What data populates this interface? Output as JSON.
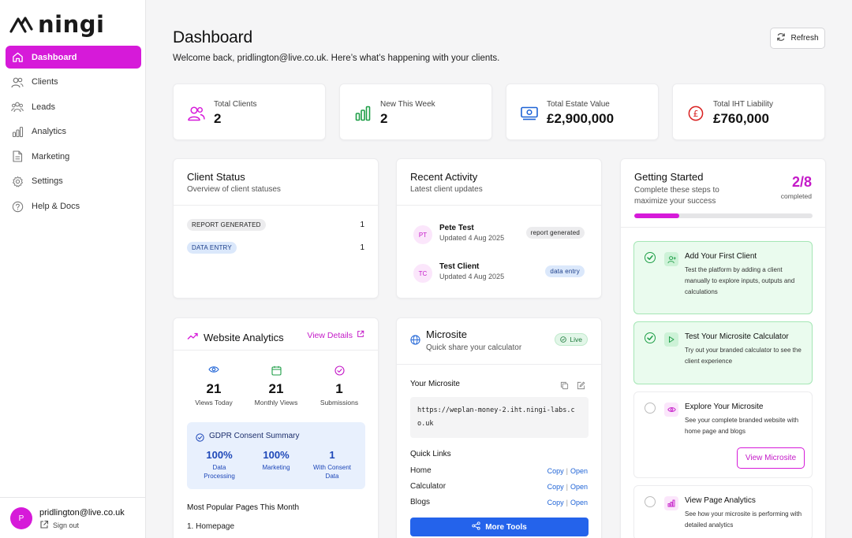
{
  "brand": {
    "name": "ningi",
    "accent": "#d61ad9"
  },
  "sidebar": {
    "items": [
      {
        "label": "Dashboard",
        "icon": "home-icon",
        "active": true
      },
      {
        "label": "Clients",
        "icon": "users-icon"
      },
      {
        "label": "Leads",
        "icon": "group-icon"
      },
      {
        "label": "Analytics",
        "icon": "bar-chart-icon"
      },
      {
        "label": "Marketing",
        "icon": "document-icon"
      },
      {
        "label": "Settings",
        "icon": "gear-icon"
      },
      {
        "label": "Help & Docs",
        "icon": "help-icon"
      }
    ],
    "user": {
      "initial": "P",
      "email": "pridlington@live.co.uk",
      "signout": "Sign out"
    }
  },
  "header": {
    "title": "Dashboard",
    "subtitle": "Welcome back, pridlington@live.co.uk. Here’s what’s happening with your clients.",
    "refresh": "Refresh"
  },
  "stats": [
    {
      "label": "Total Clients",
      "value": "2",
      "icon": "users-icon",
      "color": "#d61ad9"
    },
    {
      "label": "New This Week",
      "value": "2",
      "icon": "bar-chart-icon",
      "color": "#1e9e47"
    },
    {
      "label": "Total Estate Value",
      "value": "£2,900,000",
      "icon": "banknote-icon",
      "color": "#1e63d6"
    },
    {
      "label": "Total IHT Liability",
      "value": "£760,000",
      "icon": "pound-icon",
      "color": "#d92020"
    }
  ],
  "client_status": {
    "title": "Client Status",
    "subtitle": "Overview of client statuses",
    "rows": [
      {
        "label": "REPORT GENERATED",
        "count": "1"
      },
      {
        "label": "DATA ENTRY",
        "count": "1"
      }
    ]
  },
  "recent_activity": {
    "title": "Recent Activity",
    "subtitle": "Latest client updates",
    "items": [
      {
        "initials": "PT",
        "name": "Pete Test",
        "date": "Updated 4 Aug 2025",
        "status": "report generated"
      },
      {
        "initials": "TC",
        "name": "Test Client",
        "date": "Updated 4 Aug 2025",
        "status": "data entry"
      }
    ]
  },
  "getting_started": {
    "title": "Getting Started",
    "subtitle": "Complete these steps to maximize your success",
    "progress_text": "2/8",
    "progress_label": "completed",
    "progress_fraction": 0.25,
    "steps": [
      {
        "title": "Add Your First Client",
        "desc": "Test the platform by adding a client manually to explore inputs, outputs and calculations",
        "done": true,
        "icon": "user-plus-icon"
      },
      {
        "title": "Test Your Microsite Calculator",
        "desc": "Try out your branded calculator to see the client experience",
        "done": true,
        "icon": "play-icon"
      },
      {
        "title": "Explore Your Microsite",
        "desc": "See your complete branded website with home page and blogs",
        "done": false,
        "icon": "eye-icon",
        "button": "View Microsite"
      },
      {
        "title": "View Page Analytics",
        "desc": "See how your microsite is performing with detailed analytics",
        "done": false,
        "icon": "bar-chart-icon"
      }
    ]
  },
  "website_analytics": {
    "title": "Website Analytics",
    "link": "View Details",
    "stats": [
      {
        "value": "21",
        "label": "Views Today",
        "icon": "eye-icon"
      },
      {
        "value": "21",
        "label": "Monthly Views",
        "icon": "calendar-icon"
      },
      {
        "value": "1",
        "label": "Submissions",
        "icon": "check-circle-icon"
      }
    ],
    "gdpr": {
      "title": "GDPR Consent Summary",
      "items": [
        {
          "value": "100%",
          "label": "Data Processing"
        },
        {
          "value": "100%",
          "label": "Marketing"
        },
        {
          "value": "1",
          "label": "With Consent Data"
        }
      ]
    },
    "popular_title": "Most Popular Pages This Month",
    "popular": [
      "1. Homepage"
    ]
  },
  "microsite": {
    "title": "Microsite",
    "subtitle": "Quick share your calculator",
    "status": "Live",
    "your_label": "Your Microsite",
    "url": "https://weplan-money-2.iht.ningi-labs.co.uk",
    "quick_links_title": "Quick Links",
    "links": [
      {
        "label": "Home",
        "copy": "Copy",
        "open": "Open"
      },
      {
        "label": "Calculator",
        "copy": "Copy",
        "open": "Open"
      },
      {
        "label": "Blogs",
        "copy": "Copy",
        "open": "Open"
      }
    ],
    "more_tools": "More Tools"
  }
}
